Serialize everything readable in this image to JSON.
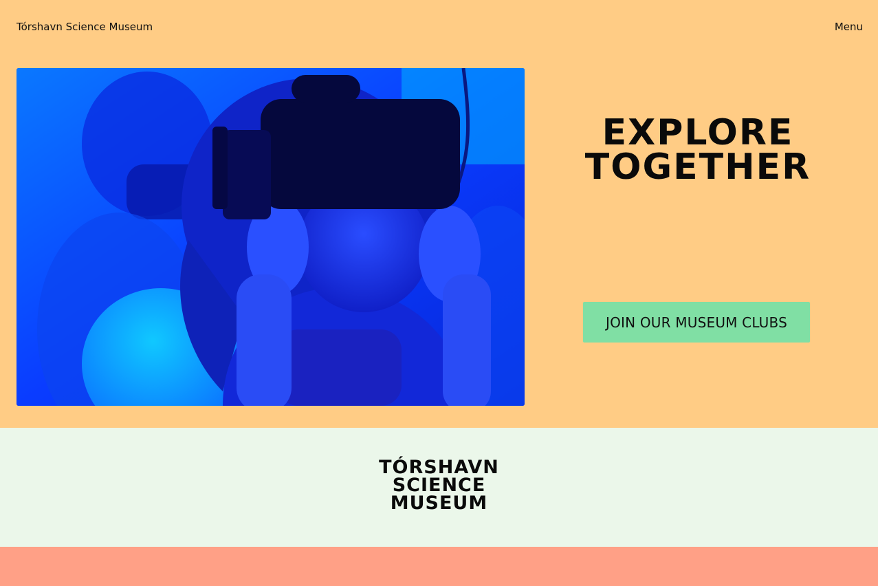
{
  "header": {
    "site_title": "Tórshavn Science Museum",
    "menu_label": "Menu"
  },
  "hero": {
    "headline_line1": "EXPLORE",
    "headline_line2": "TOGETHER",
    "cta_label": "JOIN OUR MUSEUM CLUBS",
    "image_alt": "Child wearing a VR headset"
  },
  "footer": {
    "logo_line1": "TÓRSHAVN",
    "logo_line2": "SCIENCE",
    "logo_line3": "MUSEUM"
  },
  "colors": {
    "hero_background": "#ffcc85",
    "cta_background": "#80dfa4",
    "footer_background": "#ebf7ea",
    "bottom_band": "#ffa086",
    "image_tint": "#0a3cff"
  }
}
